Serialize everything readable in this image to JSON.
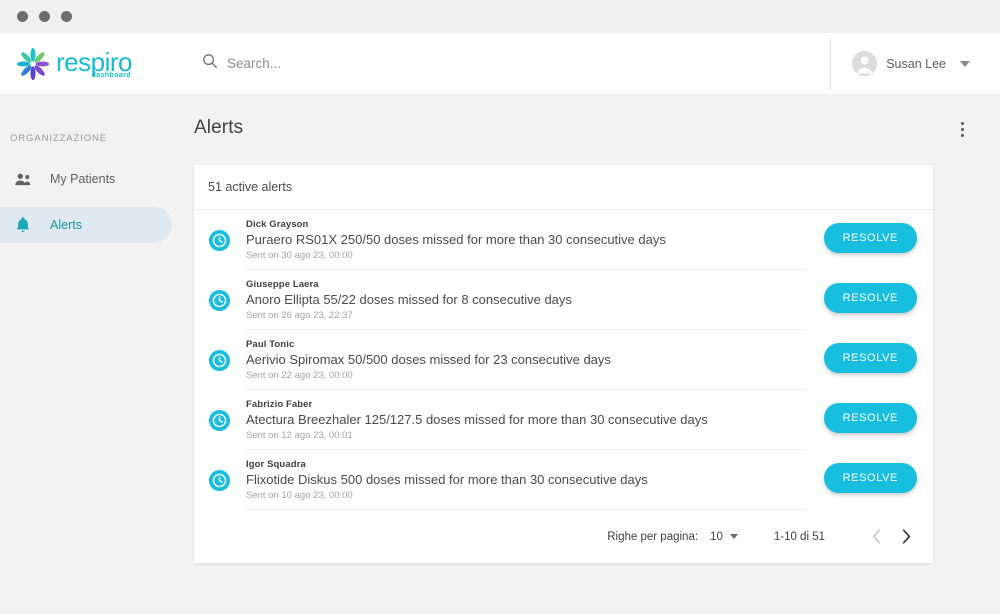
{
  "window": {
    "dots": [
      "close",
      "minimize",
      "maximize"
    ]
  },
  "brand": {
    "name": "respiro",
    "subtitle": "dashboard",
    "logo_icon": "pinwheel-logo-icon",
    "accent_color": "#14bcd4"
  },
  "search": {
    "icon": "search-icon",
    "placeholder": "Search...",
    "value": ""
  },
  "user": {
    "name": "Susan Lee",
    "avatar_icon": "user-avatar-icon",
    "caret_icon": "chevron-down-icon"
  },
  "sidebar": {
    "section_label": "ORGANIZZAZIONE",
    "items": [
      {
        "label": "My Patients",
        "icon": "people-icon",
        "active": false
      },
      {
        "label": "Alerts",
        "icon": "bell-icon",
        "active": true
      }
    ],
    "active_color": "#1793a3",
    "active_bg": "#e1e9f0"
  },
  "main": {
    "page_title": "Alerts",
    "kebab_icon": "more-vertical-icon"
  },
  "card": {
    "header_text": "51 active alerts",
    "resolve_label": "RESOLVE",
    "resolve_color": "#17bedd",
    "row_icon": "clock-alert-icon",
    "alerts": [
      {
        "patient": "Dick Grayson",
        "message": "Puraero RS01X 250/50 doses missed for more than 30 consecutive days",
        "sent": "Sent on 30 ago 23, 00:00"
      },
      {
        "patient": "Giuseppe Laera",
        "message": "Anoro Ellipta 55/22 doses missed for 8 consecutive days",
        "sent": "Sent on 26 ago 23, 22:37"
      },
      {
        "patient": "Paul Tonic",
        "message": "Aerivio Spiromax 50/500 doses missed for 23 consecutive days",
        "sent": "Sent on 22 ago 23, 00:00"
      },
      {
        "patient": "Fabrizio Faber",
        "message": "Atectura Breezhaler 125/127.5 doses missed for more than 30 consecutive days",
        "sent": "Sent on 12 ago 23, 00:01"
      },
      {
        "patient": "Igor Squadra",
        "message": "Flixotide Diskus 500 doses missed for more than 30 consecutive days",
        "sent": "Sent on 10 ago 23, 00:00"
      }
    ]
  },
  "pagination": {
    "rows_per_page_label": "Righe per pagina:",
    "rows_per_page_value": "10",
    "range_text": "1-10 di 51",
    "prev_icon": "chevron-left-icon",
    "next_icon": "chevron-right-icon",
    "prev_enabled": false,
    "next_enabled": true
  }
}
